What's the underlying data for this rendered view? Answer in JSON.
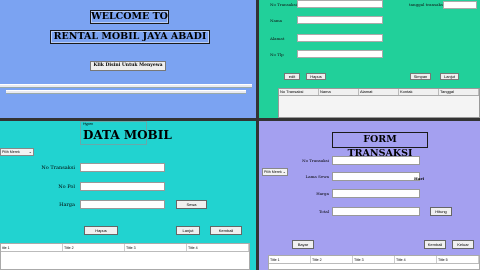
{
  "welcome": {
    "title": "WELCOME TO",
    "subtitle": "RENTAL MOBIL JAYA ABADI",
    "enter_button": "Klik Disini Untuk Menyewa"
  },
  "transaksi_list": {
    "fields": [
      "No Transaksi",
      "Nama",
      "Alamat",
      "No Tlp"
    ],
    "tanggal_label": "tanggal transaksi",
    "buttons": {
      "edit": "edit",
      "hapus": "Hapus",
      "simpan": "Simpan",
      "lanjut": "Lanjut"
    },
    "columns": [
      "No Transaksi",
      "Nama",
      "Alamat",
      "Kontak",
      "Tanggal"
    ]
  },
  "data_mobil": {
    "frame_label": "Hypen",
    "title": "DATA MOBIL",
    "combo_value": "Pilih Merek",
    "fields": [
      "No Transaksi",
      "No Pol",
      "Harga"
    ],
    "buttons": {
      "sewa": "Sewa",
      "hapus": "Hapus",
      "lanjut": "Lanjut",
      "kembali": "Kembali"
    },
    "columns": [
      "itle 1",
      "Title 2",
      "Title 3",
      "Title 4"
    ]
  },
  "form_transaksi": {
    "title": "FORM TRANSAKSI",
    "combo_value": "Pilih Merek",
    "fields": [
      "No Transaksi",
      "Lama Sewa",
      "Harga",
      "Total"
    ],
    "hari_suffix": "Hari",
    "buttons": {
      "bayar": "Bayar",
      "hitung": "Hitung",
      "kembali": "Kembali",
      "keluar": "Keluar"
    },
    "columns": [
      "Title 1",
      "Title 2",
      "Title 3",
      "Title 4",
      "Title 5"
    ]
  },
  "colors": {
    "welcome_bg": "#7ba3f2",
    "transaksi_bg": "#21d09a",
    "mobil_bg": "#21d3d0",
    "form_bg": "#a4a0f0"
  }
}
